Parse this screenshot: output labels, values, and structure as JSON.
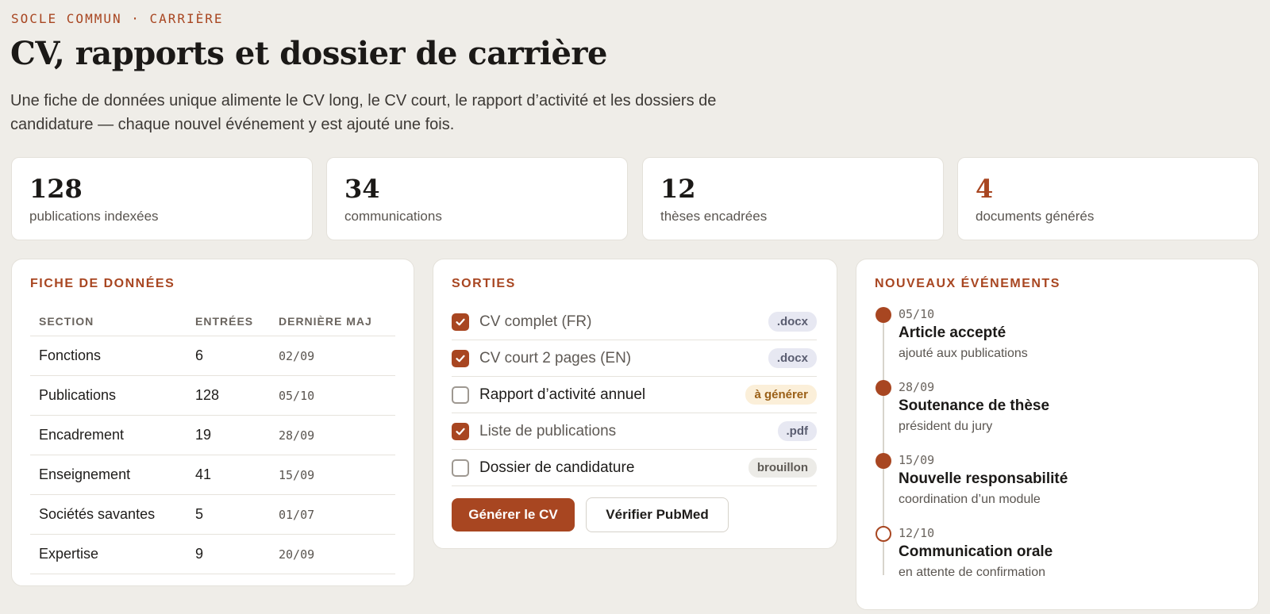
{
  "header": {
    "eyebrow": "SOCLE COMMUN · CARRIÈRE",
    "title": "CV, rapports et dossier de carrière",
    "intro": "Une fiche de données unique alimente le CV long, le CV court, le rapport d’activité et les dossiers de candidature — chaque nouvel événement y est ajouté une fois."
  },
  "stats": [
    {
      "value": "128",
      "label": "publications indexées"
    },
    {
      "value": "34",
      "label": "communications"
    },
    {
      "value": "12",
      "label": "thèses encadrées"
    },
    {
      "value": "4",
      "label": "documents générés"
    }
  ],
  "sheet": {
    "title": "FICHE DE DONNÉES",
    "columns": [
      "SECTION",
      "ENTRÉES",
      "DERNIÈRE MAJ"
    ],
    "rows": [
      {
        "section": "Fonctions",
        "entries": "6",
        "updated": "02/09"
      },
      {
        "section": "Publications",
        "entries": "128",
        "updated": "05/10"
      },
      {
        "section": "Encadrement",
        "entries": "19",
        "updated": "28/09"
      },
      {
        "section": "Enseignement",
        "entries": "41",
        "updated": "15/09"
      },
      {
        "section": "Sociétés savantes",
        "entries": "5",
        "updated": "01/07"
      },
      {
        "section": "Expertise",
        "entries": "9",
        "updated": "20/09"
      }
    ]
  },
  "outputs": {
    "title": "SORTIES",
    "items": [
      {
        "label": "CV complet (FR)",
        "checked": true,
        "tag": ".docx"
      },
      {
        "label": "CV court 2 pages (EN)",
        "checked": true,
        "tag": ".docx"
      },
      {
        "label": "Rapport d’activité annuel",
        "checked": false,
        "tag": "à générer"
      },
      {
        "label": "Liste de publications",
        "checked": true,
        "tag": ".pdf"
      },
      {
        "label": "Dossier de candidature",
        "checked": false,
        "tag": "brouillon"
      }
    ],
    "primary_button": "Générer le CV",
    "secondary_button": "Vérifier PubMed"
  },
  "events": {
    "title": "NOUVEAUX ÉVÉNEMENTS",
    "items": [
      {
        "date": "05/10",
        "title": "Article accepté",
        "subtitle": "ajouté aux publications",
        "status": "done"
      },
      {
        "date": "28/09",
        "title": "Soutenance de thèse",
        "subtitle": "président du jury",
        "status": "done"
      },
      {
        "date": "15/09",
        "title": "Nouvelle responsabilité",
        "subtitle": "coordination d’un module",
        "status": "done"
      },
      {
        "date": "12/10",
        "title": "Communication orale",
        "subtitle": "en attente de confirmation",
        "status": "pending"
      }
    ]
  },
  "colors": {
    "accent": "#a84621",
    "background": "#efede8"
  }
}
